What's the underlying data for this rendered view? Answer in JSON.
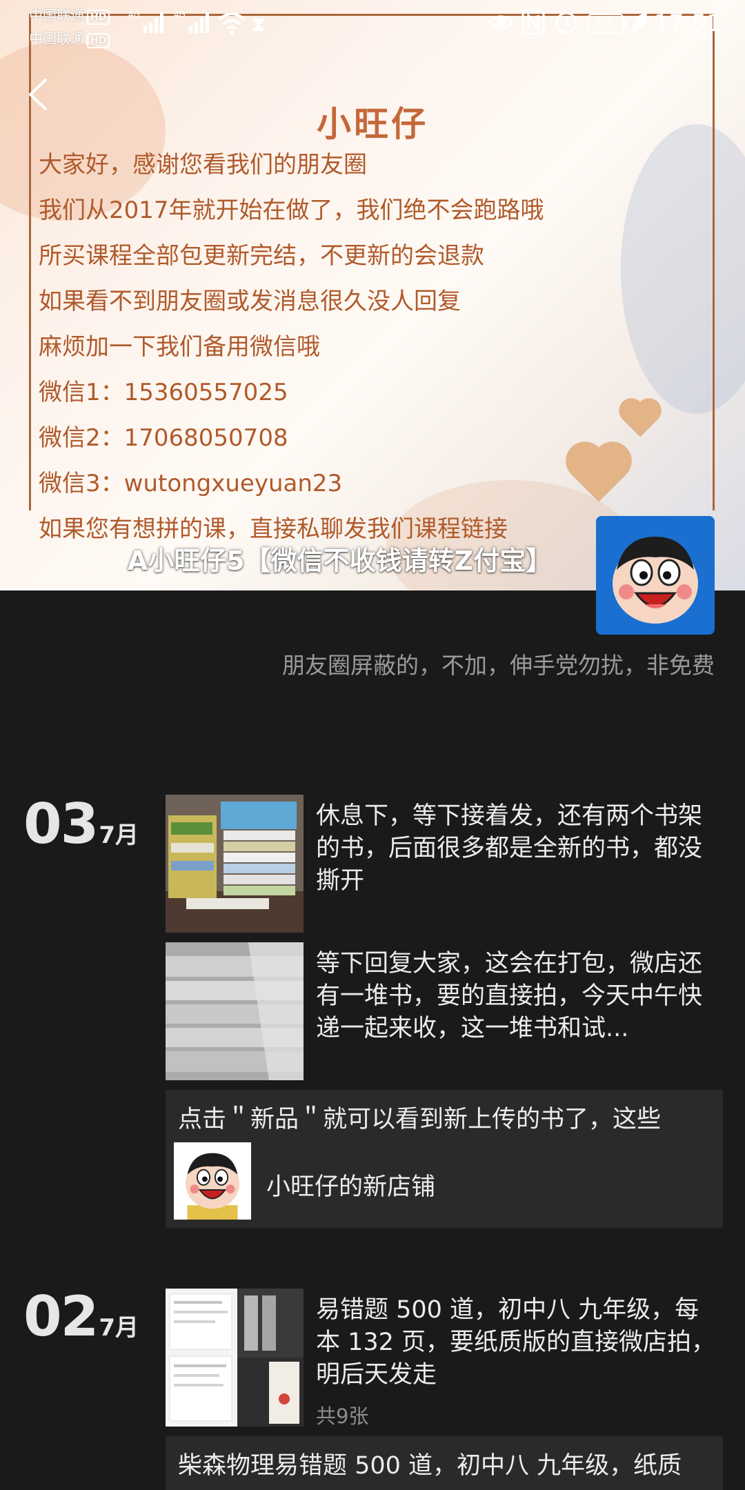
{
  "status_bar": {
    "carrier1": "中国联通",
    "carrier2": "中国联通",
    "hd_label": "HD",
    "network1": "4G",
    "network2": "4G",
    "battery": "93",
    "time": "17:51"
  },
  "cover": {
    "poster_title": "小旺仔",
    "poster_lines": [
      "大家好，感谢您看我们的朋友圈",
      "我们从2017年就开始在做了，我们绝不会跑路哦",
      "所买课程全部包更新完结，不更新的会退款",
      "如果看不到朋友圈或发消息很久没人回复",
      "麻烦加一下我们备用微信哦",
      "微信1：15360557025",
      "微信2：17068050708",
      "微信3：wutongxueyuan23",
      "如果您有想拼的课，直接私聊发我们课程链接"
    ],
    "profile_name": "A小旺仔5【微信不收钱请转Z付宝】"
  },
  "signature": "朋友圈屏蔽的，不加，伸手党勿扰，非免费",
  "days": [
    {
      "day": "03",
      "month": "7月",
      "posts": [
        {
          "text": "休息下，等下接着发，还有两个书架的书，后面很多都是全新的书，都没撕开"
        },
        {
          "text": "等下回复大家，这会在打包，微店还有一堆书，要的直接拍，今天中午快递一起来收，这一堆书和试..."
        }
      ],
      "share": {
        "text": "点击＂新品＂就可以看到新上传的书了，这些",
        "name": "小旺仔的新店铺"
      }
    },
    {
      "day": "02",
      "month": "7月",
      "posts": [
        {
          "text": "易错题 500 道，初中八 九年级，每本 132 页，要纸质版的直接微店拍，明后天发走",
          "count": "共9张"
        }
      ],
      "share": {
        "text": "柴森物理易错题 500 道，初中八 九年级，纸质"
      }
    }
  ]
}
